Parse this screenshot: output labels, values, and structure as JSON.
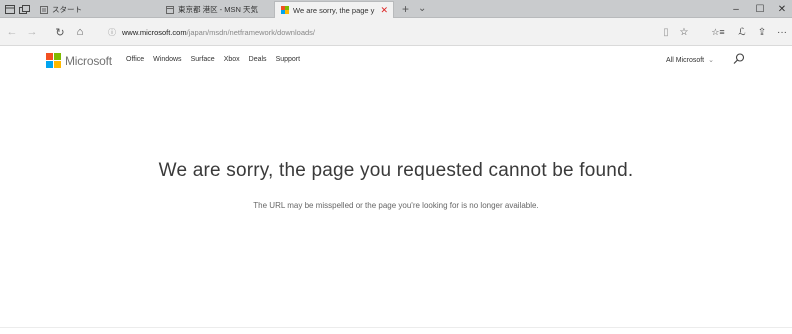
{
  "tabbar": {
    "tabs": [
      {
        "label": "スタート",
        "active": false
      },
      {
        "label": "東京都 港区 - MSN 天気",
        "active": false
      },
      {
        "label": "We are sorry, the page y",
        "active": true
      }
    ],
    "new_tab_symbol": "+",
    "tab_list_symbol": "⌄",
    "icons": {
      "set_aside": "tabs-set-aside-icon",
      "show_tabs": "tabs-preview-icon",
      "minimize": "minimize-icon",
      "maximize": "maximize-icon",
      "close": "close-icon"
    },
    "window_controls": {
      "minimize": "–",
      "maximize": "☐",
      "close": "✕"
    }
  },
  "addressbar": {
    "url_host": "www.microsoft.com",
    "url_path": "/japan/msdn/netframework/downloads/",
    "buttons": {
      "back": "←",
      "forward": "→",
      "refresh": "↻",
      "home": "⌂",
      "reading_view": "▯",
      "favorite": "☆",
      "favorites_hub": "☆≡",
      "notes": "ℒ",
      "share": "⇪",
      "more": "···"
    }
  },
  "site": {
    "logo_text": "Microsoft",
    "logo_colors": [
      "#f25022",
      "#7fba00",
      "#00a4ef",
      "#ffb900"
    ],
    "nav": [
      "Office",
      "Windows",
      "Surface",
      "Xbox",
      "Deals",
      "Support"
    ],
    "all_microsoft": "All Microsoft",
    "all_microsoft_chevron": "⌄"
  },
  "main": {
    "title": "We are sorry, the page you requested cannot be found.",
    "subtitle": "The URL may be misspelled or the page you're looking for is no longer available."
  }
}
